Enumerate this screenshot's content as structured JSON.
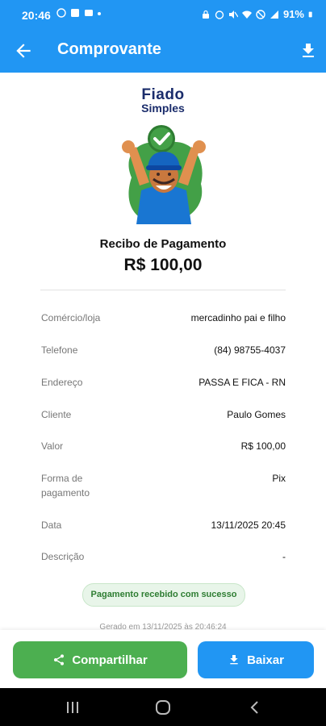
{
  "status_bar": {
    "time": "20:46",
    "battery": "91%"
  },
  "app_bar": {
    "title": "Comprovante",
    "back_icon": "arrow-left-icon",
    "download_icon": "download-icon"
  },
  "logo": {
    "line1": "Fiado",
    "line2": "Simples"
  },
  "receipt": {
    "title": "Recibo de Pagamento",
    "amount": "R$ 100,00"
  },
  "details": [
    {
      "label": "Comércio/loja",
      "value": "mercadinho pai e filho"
    },
    {
      "label": "Telefone",
      "value": "(84) 98755-4037"
    },
    {
      "label": "Endereço",
      "value": "PASSA E FICA - RN"
    },
    {
      "label": "Cliente",
      "value": "Paulo Gomes"
    },
    {
      "label": "Valor",
      "value": "R$ 100,00"
    },
    {
      "label": "Forma de pagamento",
      "value": "Pix"
    },
    {
      "label": "Data",
      "value": "13/11/2025 20:45"
    },
    {
      "label": "Descrição",
      "value": "-"
    }
  ],
  "success_badge": "Pagamento recebido com sucesso",
  "generated_text": "Gerado em 13/11/2025 às 20:46:24",
  "actions": {
    "share_label": "Compartilhar",
    "save_label": "Baixar"
  },
  "colors": {
    "primary": "#2196F3",
    "success": "#4CAF50",
    "logo": "#1a2c6b"
  }
}
